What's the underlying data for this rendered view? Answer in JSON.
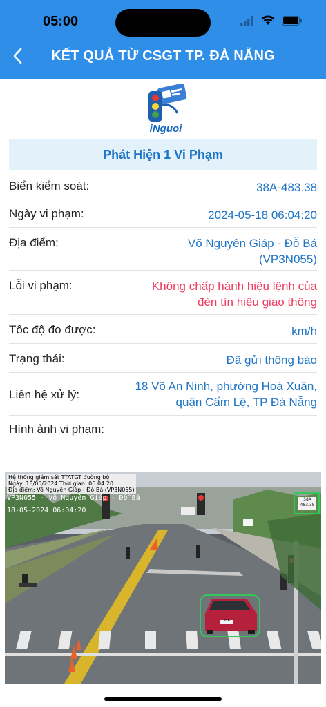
{
  "status": {
    "time": "05:00"
  },
  "nav": {
    "title": "KẾT QUẢ TỪ CSGT TP. ĐÀ NẴNG"
  },
  "logo": {
    "text": "iNguoi"
  },
  "result": {
    "summary": "Phát Hiện 1 Vi Phạm"
  },
  "details": {
    "plate_label": "Biển kiểm soát:",
    "plate_value": "38A-483.38",
    "date_label": "Ngày vi phạm:",
    "date_value": "2024-05-18 06:04:20",
    "location_label": "Địa điểm:",
    "location_line1": "Võ Nguyên Giáp - Đỗ Bá",
    "location_line2": "(VP3N055)",
    "violation_label": "Lỗi vi phạm:",
    "violation_line1": "Không chấp hành hiệu lệnh của",
    "violation_line2": "đèn tín hiệu giao thông",
    "speed_label": "Tốc độ đo được:",
    "speed_value": "km/h",
    "status_label": "Trạng thái:",
    "status_value": "Đã gửi thông báo",
    "contact_label": "Liên hệ xử lý:",
    "contact_line1": "18 Võ An Ninh, phường Hoà Xuân,",
    "contact_line2": "quận Cẩm Lệ, TP Đà Nẵng",
    "image_label": "Hình ảnh vi phạm:"
  },
  "photo": {
    "caption_line1": "Hệ thống giám sát TTATGT đường bộ",
    "caption_line2": "Ngày: 18/05/2024  Thời gian: 06:04:20",
    "caption_line3": "Địa điểm: Võ Nguyên Giáp - Đỗ Bá (VP3N055)",
    "cam_id": "VP3N055 - Võ Nguyên Giáp - Đỗ Bá",
    "cam_date": "18-05-2024 06:04:20",
    "plate_crop_top": "38A",
    "plate_crop_bottom": "483.38",
    "car_plate": "38A"
  },
  "colors": {
    "header": "#2f8fe8",
    "accent": "#1e74c6",
    "violation": "#ef3b5e"
  },
  "icons": {
    "back": "chevron-left-icon",
    "signal": "cellular-signal-icon",
    "wifi": "wifi-icon",
    "battery": "battery-icon"
  }
}
